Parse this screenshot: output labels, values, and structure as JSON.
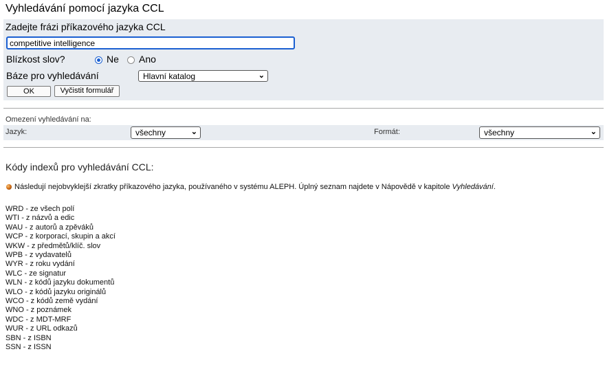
{
  "page_title": "Vyhledávání pomocí jazyka CCL",
  "form": {
    "subtitle": "Zadejte frázi příkazového jazyka CCL",
    "query_value": "competitive intelligence",
    "proximity_label": "Blízkost slov?",
    "proximity_options": [
      "Ne",
      "Ano"
    ],
    "proximity_selected": "Ne",
    "base_label": "Báze pro vyhledávání",
    "base_value": "Hlavní katalog",
    "ok_label": "OK",
    "clear_label": "Vyčistit formulář"
  },
  "limits": {
    "title": "Omezení vyhledávání na:",
    "language_label": "Jazyk:",
    "language_value": "všechny",
    "format_label": "Formát:",
    "format_value": "všechny"
  },
  "codes": {
    "title": "Kódy indexů pro vyhledávání CCL:",
    "note_text": "Následují nejobvyklejší zkratky příkazového jazyka, používaného v systému ALEPH. Úplný seznam najdete v Nápovědě v kapitole ",
    "note_link": "Vyhledávání",
    "note_end": ".",
    "items": [
      "WRD - ze všech polí",
      "WTI - z názvů a edic",
      "WAU - z autorů a zpěváků",
      "WCP - z korporací, skupin a akcí",
      "WKW - z předmětů/klíč. slov",
      "WPB - z vydavatelů",
      "WYR - z roku vydání",
      "WLC - ze signatur",
      "WLN - z kódů jazyku dokumentů",
      "WLO - z kódů jazyku originálů",
      "WCO - z kódů země vydání",
      "WNO - z poznámek",
      "WDC - z MDT-MRF",
      "WUR - z URL odkazů",
      "SBN - z ISBN",
      "SSN - z ISSN"
    ]
  }
}
